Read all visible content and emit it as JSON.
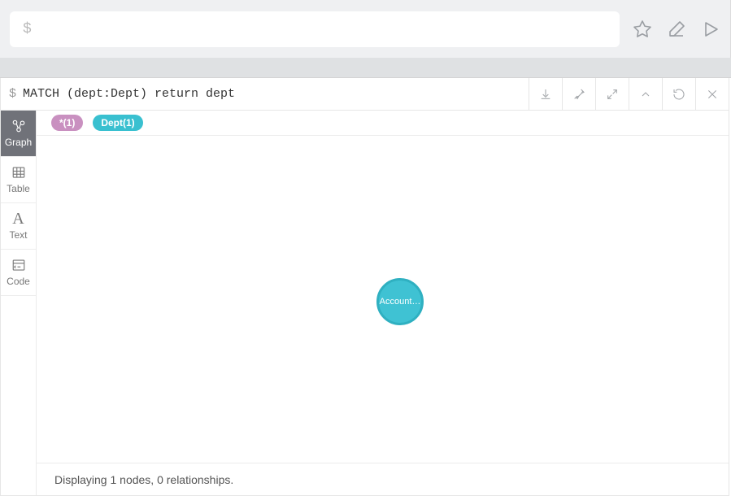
{
  "editor": {
    "placeholder": "$"
  },
  "query": {
    "prompt": "$",
    "text": "MATCH (dept:Dept) return dept"
  },
  "chips": {
    "star": "*(1)",
    "dept": "Dept(1)"
  },
  "views": {
    "graph": "Graph",
    "table": "Table",
    "text": "Text",
    "code": "Code"
  },
  "node": {
    "label": "Account…"
  },
  "status": "Displaying 1 nodes, 0 relationships."
}
